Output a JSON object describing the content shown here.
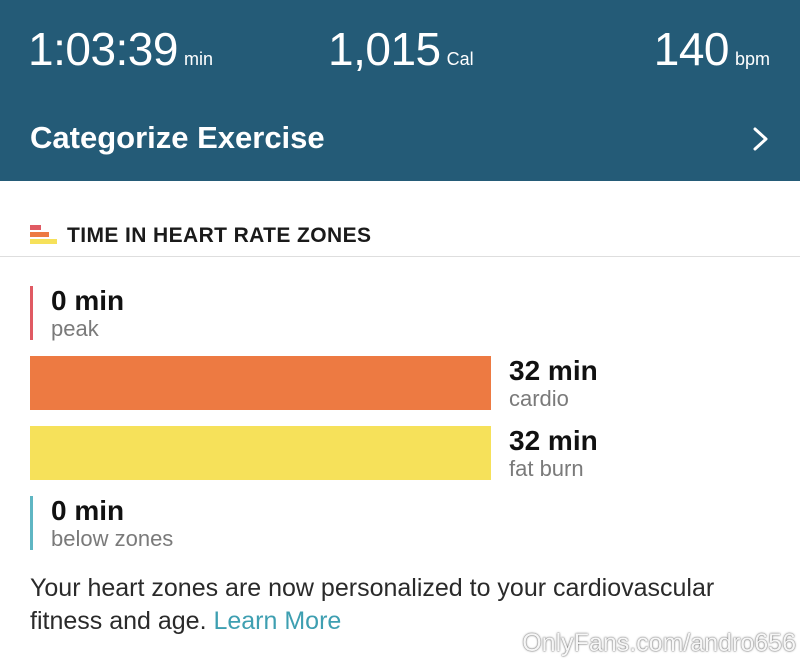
{
  "header": {
    "duration": {
      "value": "1:03:39",
      "unit": "min"
    },
    "calories": {
      "value": "1,015",
      "unit": "Cal"
    },
    "heart_rate": {
      "value": "140",
      "unit": "bpm"
    },
    "categorize_label": "Categorize Exercise"
  },
  "zones_section": {
    "title": "TIME IN HEART RATE ZONES",
    "zones": [
      {
        "minutes": "0 min",
        "name": "peak",
        "color": "#e05a63",
        "fill": 0
      },
      {
        "minutes": "32 min",
        "name": "cardio",
        "color": "#ed7a42",
        "fill": 1
      },
      {
        "minutes": "32 min",
        "name": "fat burn",
        "color": "#f6e15a",
        "fill": 1
      },
      {
        "minutes": "0 min",
        "name": "below zones",
        "color": "#5fb6c3",
        "fill": 0
      }
    ]
  },
  "footer": {
    "text": "Your heart zones are now personalized to your cardiovascular fitness and age.",
    "link": "Learn More"
  },
  "watermark": "OnlyFans.com/andro656",
  "colors": {
    "header_bg": "#245b77",
    "link": "#3e9fb1"
  }
}
